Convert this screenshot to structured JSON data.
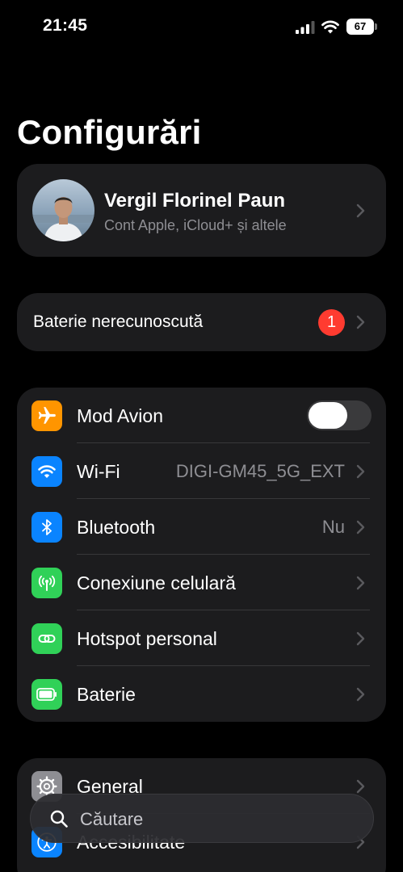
{
  "status_bar": {
    "time": "21:45",
    "battery_level": "67"
  },
  "page_title": "Configurări",
  "profile": {
    "name": "Vergil Florinel Paun",
    "subtitle": "Cont Apple, iCloud+ și altele"
  },
  "alert": {
    "label": "Baterie nerecunoscută",
    "badge_count": "1"
  },
  "network_settings": [
    {
      "label": "Mod Avion",
      "icon": "airplane-icon",
      "color": "#ff9500",
      "toggle_on": false
    },
    {
      "label": "Wi-Fi",
      "icon": "wifi-icon",
      "color": "#0a84ff",
      "value": "DIGI-GM45_5G_EXT"
    },
    {
      "label": "Bluetooth",
      "icon": "bluetooth-icon",
      "color": "#0a84ff",
      "value": "Nu"
    },
    {
      "label": "Conexiune celulară",
      "icon": "cellular-antenna-icon",
      "color": "#30d158"
    },
    {
      "label": "Hotspot personal",
      "icon": "hotspot-link-icon",
      "color": "#30d158"
    },
    {
      "label": "Baterie",
      "icon": "battery-icon",
      "color": "#30d158"
    }
  ],
  "general_settings": [
    {
      "label": "General",
      "icon": "gear-icon",
      "color": "#8e8e93"
    },
    {
      "label": "Accesibilitate",
      "icon": "accessibility-icon",
      "color": "#0a84ff"
    }
  ],
  "search": {
    "placeholder": "Căutare"
  }
}
